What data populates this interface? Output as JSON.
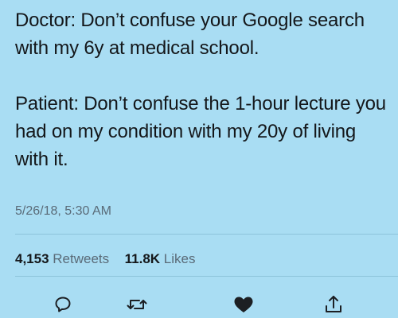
{
  "tweet": {
    "paragraph1": "Doctor: Don’t confuse your Google search with my 6y at medical school.",
    "paragraph2": "Patient: Don’t confuse the 1-hour lecture you had on my condition with my 20y of living with it.",
    "timestamp": "5/26/18, 5:30 AM"
  },
  "stats": {
    "retweet_count": "4,153",
    "retweet_label": "Retweets",
    "like_count": "11.8K",
    "like_label": "Likes"
  },
  "actions": {
    "reply_icon": "reply-icon",
    "retweet_icon": "retweet-icon",
    "like_icon": "heart-icon",
    "share_icon": "share-icon"
  },
  "colors": {
    "background": "#a9ddf3",
    "text": "#14171a",
    "secondary_text": "#5a6b78",
    "icon": "#1c1f23"
  }
}
